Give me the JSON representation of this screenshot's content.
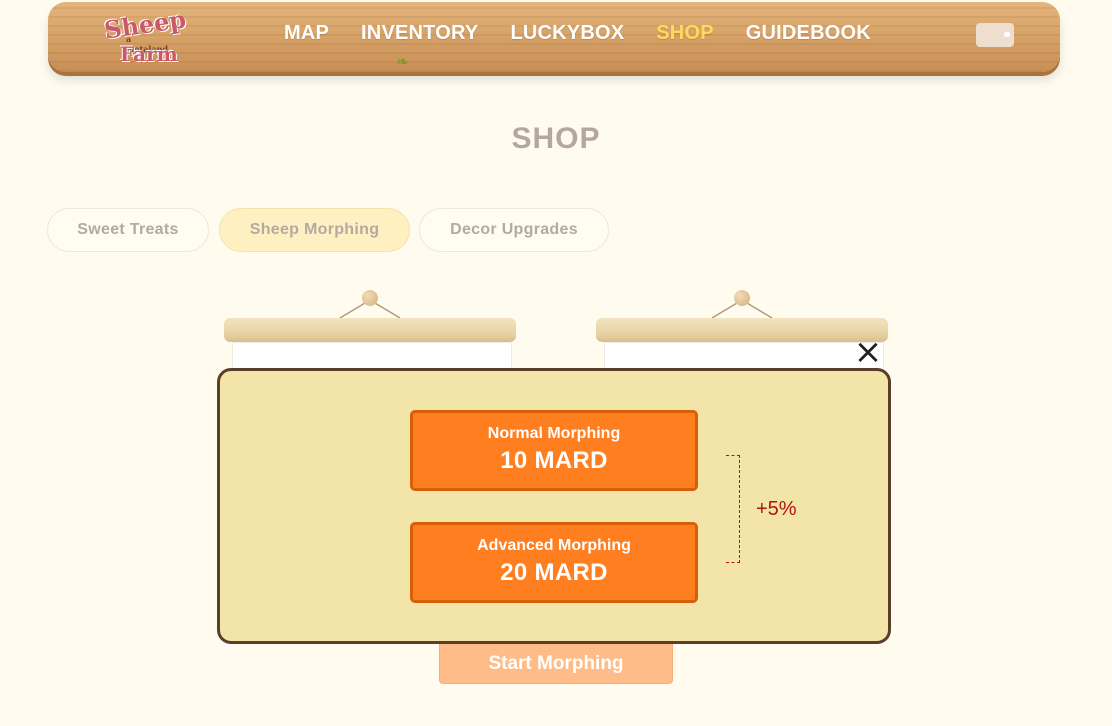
{
  "logo": {
    "line1": "Sheep",
    "line2": "a metaland",
    "line3": "Farm"
  },
  "nav": {
    "items": [
      {
        "label": "MAP"
      },
      {
        "label": "INVENTORY"
      },
      {
        "label": "LUCKYBOX"
      },
      {
        "label": "SHOP",
        "active": true
      },
      {
        "label": "GUIDEBOOK"
      }
    ],
    "active_color": "#ffd95c"
  },
  "page": {
    "title": "SHOP"
  },
  "tabs": [
    {
      "label": "Sweet Treats"
    },
    {
      "label": "Sheep Morphing",
      "active": true
    },
    {
      "label": "Decor Upgrades"
    }
  ],
  "start_button": {
    "label": "Start Morphing"
  },
  "modal": {
    "close_icon": "×",
    "options": [
      {
        "name": "Normal Morphing",
        "price": "10 MARD"
      },
      {
        "name": "Advanced Morphing",
        "price": "20 MARD"
      }
    ],
    "bonus": "+5%"
  },
  "colors": {
    "background": "#fffcef",
    "modal_bg": "#f3e5a7",
    "modal_border": "#5b3d2c",
    "option_bg": "#ff7e1f",
    "bonus_text": "#b01414",
    "start_button": "#ffbc88"
  }
}
